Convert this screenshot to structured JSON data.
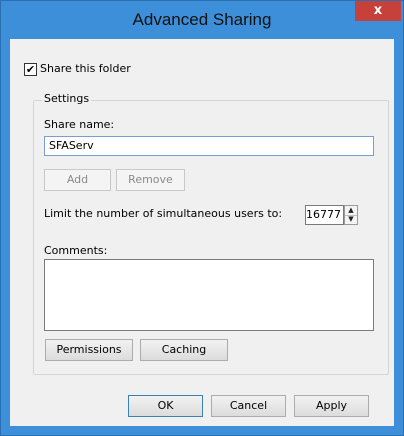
{
  "window": {
    "title": "Advanced Sharing",
    "close_glyph": "x"
  },
  "share_checkbox": {
    "label": "Share this folder",
    "checked": true,
    "check_glyph": "✔"
  },
  "settings": {
    "legend": "Settings",
    "share_name_label": "Share name:",
    "share_name_value": "SFAServ",
    "add_label": "Add",
    "remove_label": "Remove",
    "limit_label": "Limit the number of simultaneous users to:",
    "limit_value": "16777",
    "comments_label": "Comments:",
    "comments_value": "",
    "permissions_label": "Permissions",
    "caching_label": "Caching"
  },
  "footer": {
    "ok_label": "OK",
    "cancel_label": "Cancel",
    "apply_label": "Apply"
  },
  "colors": {
    "titlebar": "#3d8fd9",
    "close_button": "#c7413b",
    "dialog_bg": "#f0f0f0"
  }
}
